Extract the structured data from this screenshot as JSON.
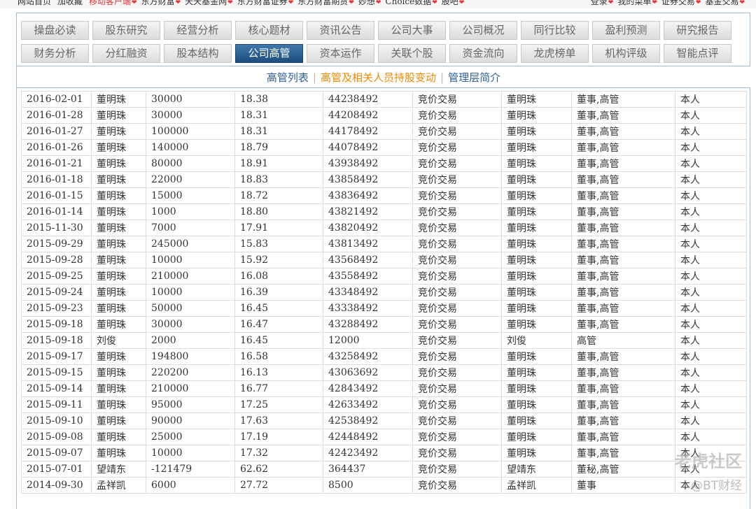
{
  "topbar": {
    "left": [
      "网站首页",
      "加收藏",
      "移动客户端",
      "东方财富",
      "天天基金网",
      "东方财富证券",
      "东方财富期货",
      "妙想",
      "Choice数据",
      "股吧"
    ],
    "right": [
      "登录",
      "我的菜单",
      "证券交易",
      "基金交易"
    ]
  },
  "nav_row1": [
    "操盘必读",
    "股东研究",
    "经营分析",
    "核心题材",
    "资讯公告",
    "公司大事",
    "公司概况",
    "同行比较",
    "盈利预测",
    "研究报告"
  ],
  "nav_row2": [
    "财务分析",
    "分红融资",
    "股本结构",
    "公司高管",
    "资本运作",
    "关联个股",
    "资金流向",
    "龙虎榜单",
    "机构评级",
    "智能点评"
  ],
  "active_nav": "公司高管",
  "subtabs": [
    "高管列表",
    "高管及相关人员持股变动",
    "管理层简介"
  ],
  "active_subtab": "高管及相关人员持股变动",
  "rows": [
    [
      "2016-02-01",
      "董明珠",
      "30000",
      "18.38",
      "44238492",
      "竞价交易",
      "董明珠",
      "董事,高管",
      "本人"
    ],
    [
      "2016-01-28",
      "董明珠",
      "30000",
      "18.31",
      "44208492",
      "竞价交易",
      "董明珠",
      "董事,高管",
      "本人"
    ],
    [
      "2016-01-27",
      "董明珠",
      "100000",
      "18.31",
      "44178492",
      "竞价交易",
      "董明珠",
      "董事,高管",
      "本人"
    ],
    [
      "2016-01-26",
      "董明珠",
      "140000",
      "18.79",
      "44078492",
      "竞价交易",
      "董明珠",
      "董事,高管",
      "本人"
    ],
    [
      "2016-01-21",
      "董明珠",
      "80000",
      "18.91",
      "43938492",
      "竞价交易",
      "董明珠",
      "董事,高管",
      "本人"
    ],
    [
      "2016-01-18",
      "董明珠",
      "22000",
      "18.83",
      "43858492",
      "竞价交易",
      "董明珠",
      "董事,高管",
      "本人"
    ],
    [
      "2016-01-15",
      "董明珠",
      "15000",
      "18.72",
      "43836492",
      "竞价交易",
      "董明珠",
      "董事,高管",
      "本人"
    ],
    [
      "2016-01-14",
      "董明珠",
      "1000",
      "18.80",
      "43821492",
      "竞价交易",
      "董明珠",
      "董事,高管",
      "本人"
    ],
    [
      "2015-11-30",
      "董明珠",
      "7000",
      "17.91",
      "43820492",
      "竞价交易",
      "董明珠",
      "董事,高管",
      "本人"
    ],
    [
      "2015-09-29",
      "董明珠",
      "245000",
      "15.83",
      "43813492",
      "竞价交易",
      "董明珠",
      "董事,高管",
      "本人"
    ],
    [
      "2015-09-28",
      "董明珠",
      "10000",
      "15.92",
      "43568492",
      "竞价交易",
      "董明珠",
      "董事,高管",
      "本人"
    ],
    [
      "2015-09-25",
      "董明珠",
      "210000",
      "16.08",
      "43558492",
      "竞价交易",
      "董明珠",
      "董事,高管",
      "本人"
    ],
    [
      "2015-09-24",
      "董明珠",
      "10000",
      "16.39",
      "43348492",
      "竞价交易",
      "董明珠",
      "董事,高管",
      "本人"
    ],
    [
      "2015-09-23",
      "董明珠",
      "50000",
      "16.45",
      "43338492",
      "竞价交易",
      "董明珠",
      "董事,高管",
      "本人"
    ],
    [
      "2015-09-18",
      "董明珠",
      "30000",
      "16.47",
      "43288492",
      "竞价交易",
      "董明珠",
      "董事,高管",
      "本人"
    ],
    [
      "2015-09-18",
      "刘俊",
      "2000",
      "16.45",
      "12000",
      "竞价交易",
      "刘俊",
      "高管",
      "本人"
    ],
    [
      "2015-09-17",
      "董明珠",
      "194800",
      "16.58",
      "43258492",
      "竞价交易",
      "董明珠",
      "董事,高管",
      "本人"
    ],
    [
      "2015-09-15",
      "董明珠",
      "220200",
      "16.13",
      "43063692",
      "竞价交易",
      "董明珠",
      "董事,高管",
      "本人"
    ],
    [
      "2015-09-14",
      "董明珠",
      "210000",
      "16.77",
      "42843492",
      "竞价交易",
      "董明珠",
      "董事,高管",
      "本人"
    ],
    [
      "2015-09-11",
      "董明珠",
      "95000",
      "17.25",
      "42633492",
      "竞价交易",
      "董明珠",
      "董事,高管",
      "本人"
    ],
    [
      "2015-09-10",
      "董明珠",
      "90000",
      "17.63",
      "42538492",
      "竞价交易",
      "董明珠",
      "董事,高管",
      "本人"
    ],
    [
      "2015-09-08",
      "董明珠",
      "25000",
      "17.19",
      "42448492",
      "竞价交易",
      "董明珠",
      "董事,高管",
      "本人"
    ],
    [
      "2015-09-07",
      "董明珠",
      "10000",
      "17.32",
      "42423492",
      "竞价交易",
      "董明珠",
      "董事,高管",
      "本人"
    ],
    [
      "2015-07-01",
      "望靖东",
      "-121479",
      "62.62",
      "364437",
      "竞价交易",
      "望靖东",
      "董秘,高管",
      "本人"
    ],
    [
      "2014-09-30",
      "孟祥凯",
      "6000",
      "27.72",
      "8500",
      "竞价交易",
      "孟祥凯",
      "董事",
      "本人"
    ]
  ],
  "watermark": {
    "line1": "老虎社区",
    "line2": "@BT财经"
  }
}
